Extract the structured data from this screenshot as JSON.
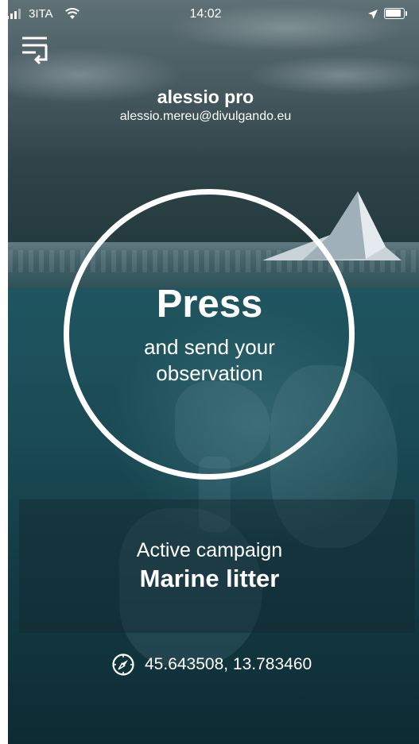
{
  "status_bar": {
    "carrier": "3ITA",
    "time": "14:02",
    "icons": [
      "signal-icon",
      "wifi-icon",
      "location-arrow-icon",
      "battery-icon"
    ]
  },
  "header": {
    "menu_icon": "menu-icon"
  },
  "user": {
    "name": "alessio pro",
    "email": "alessio.mereu@divulgando.eu"
  },
  "press_button": {
    "title": "Press",
    "subtitle_line1": "and send your",
    "subtitle_line2": "observation"
  },
  "campaign": {
    "label": "Active campaign",
    "name": "Marine litter"
  },
  "location": {
    "icon": "compass-icon",
    "coordinates": "45.643508, 13.783460"
  },
  "colors": {
    "text": "#ffffff",
    "sky": "#4a5d63",
    "sea": "#1b4c56"
  }
}
